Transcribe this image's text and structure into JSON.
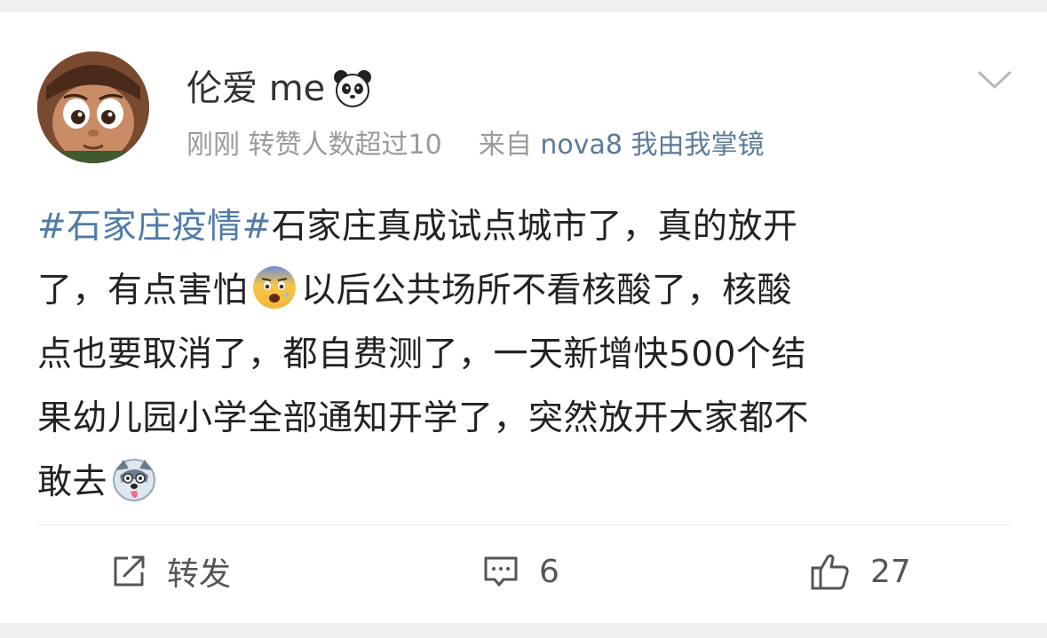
{
  "post": {
    "username": "伦爱 me",
    "username_emoji": "panda-icon",
    "time": "刚刚",
    "reposts_note": "转赞人数超过10",
    "source_prefix": "来自",
    "source_name": "nova8 我由我掌镜",
    "content": {
      "hashtag": "#石家庄疫情#",
      "line1_rest": "石家庄真成试点城市了，真的放开",
      "line2_a": "了，有点害怕",
      "emoji1": "fearful-face-emoji",
      "line2_b": "以后公共场所不看核酸了，核酸",
      "line3": "点也要取消了，都自费测了，一天新增快500个结",
      "line4": "果幼儿园小学全部通知开学了，突然放开大家都不",
      "line5": "敢去",
      "emoji2": "husky-dog-emoji"
    }
  },
  "actions": {
    "repost_label": "转发",
    "comment_count": "6",
    "like_count": "27"
  },
  "colors": {
    "hashtag": "#4f7ba8",
    "source_link": "#5c7a9b",
    "meta_gray": "#9a9a9a",
    "text": "#222222"
  }
}
